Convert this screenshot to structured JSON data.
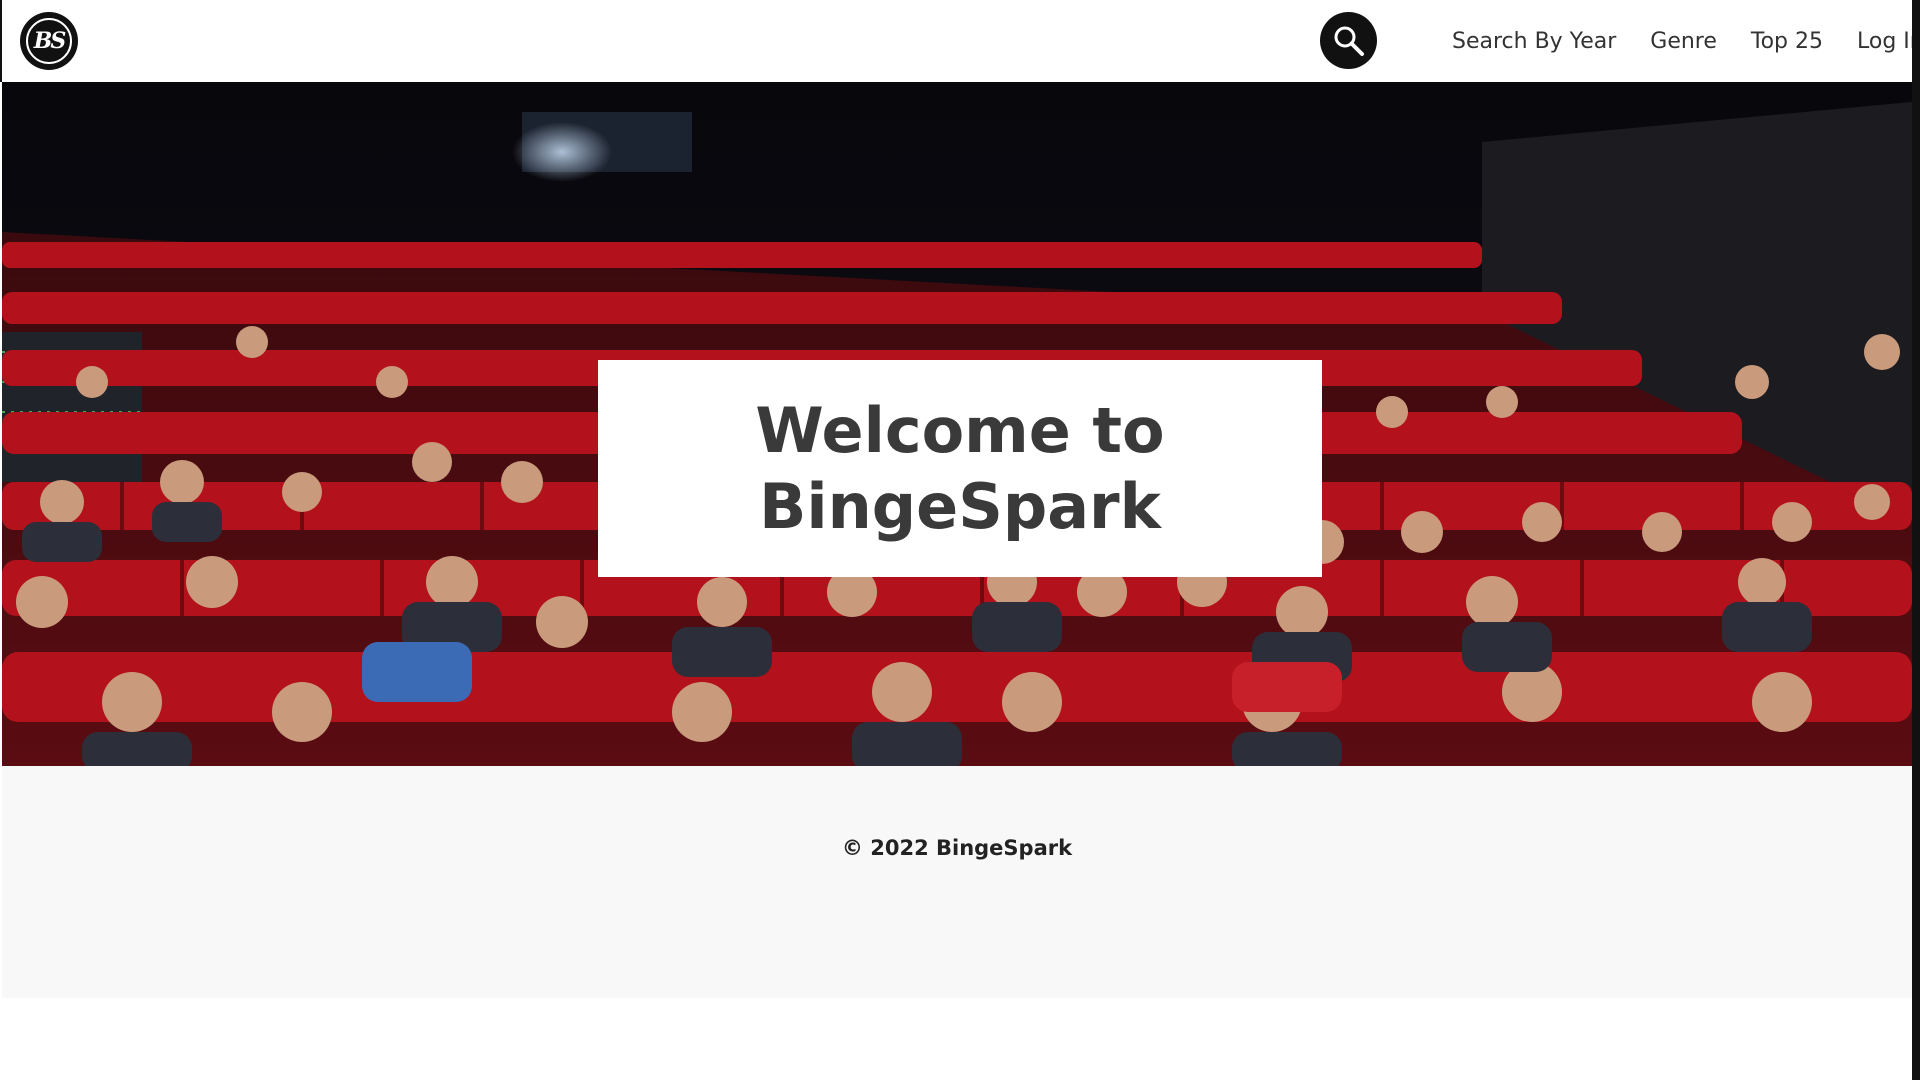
{
  "header": {
    "logo_text": "BS",
    "nav": [
      {
        "label": "Search By Year"
      },
      {
        "label": "Genre"
      },
      {
        "label": "Top 25"
      },
      {
        "label": "Log In"
      }
    ]
  },
  "hero": {
    "welcome_line1": "Welcome to",
    "welcome_line2": "BingeSpark"
  },
  "footer": {
    "copyright": "© 2022 BingeSpark"
  },
  "colors": {
    "seat_red": "#b3121c",
    "text_dark": "#333333",
    "footer_bg": "#f8f8f9"
  }
}
